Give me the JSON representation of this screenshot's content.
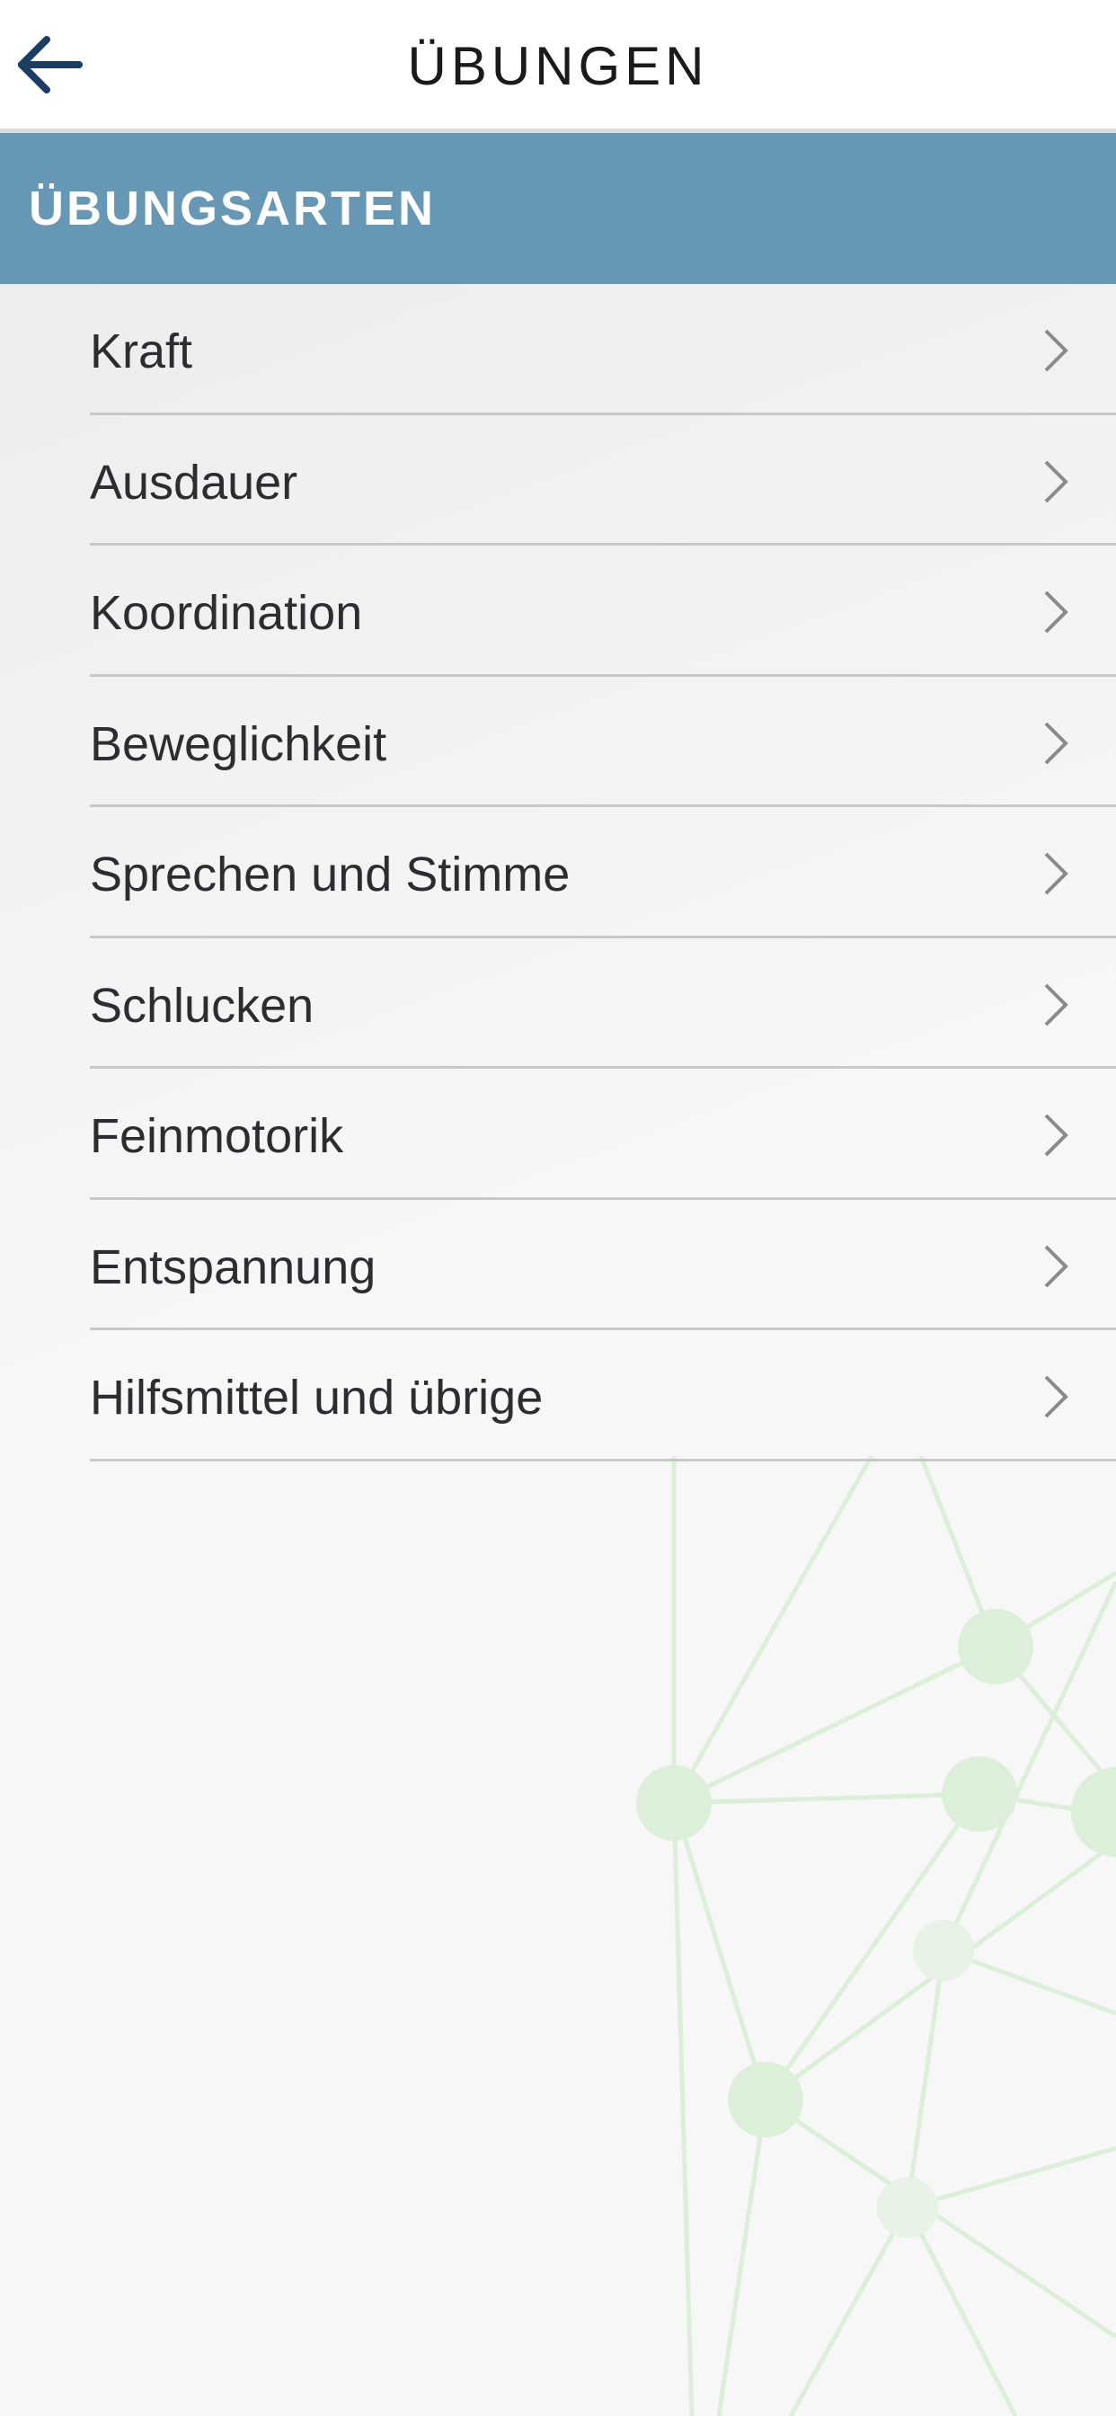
{
  "header": {
    "title": "ÜBUNGEN",
    "back_icon": "arrow-left-icon"
  },
  "section": {
    "title": "ÜBUNGSARTEN"
  },
  "list": {
    "items": [
      {
        "label": "Kraft"
      },
      {
        "label": "Ausdauer"
      },
      {
        "label": "Koordination"
      },
      {
        "label": "Beweglichkeit"
      },
      {
        "label": "Sprechen und Stimme"
      },
      {
        "label": "Schlucken"
      },
      {
        "label": "Feinmotorik"
      },
      {
        "label": "Entspannung"
      },
      {
        "label": "Hilfsmittel und übrige"
      }
    ],
    "chevron_icon": "chevron-right-icon"
  },
  "colors": {
    "header_background": "#ffffff",
    "section_background": "#6698b5",
    "back_arrow": "#1c3d63",
    "chevron": "#8a8a8a",
    "divider": "#c8c8c8",
    "background_network": "#d9ecd6"
  }
}
